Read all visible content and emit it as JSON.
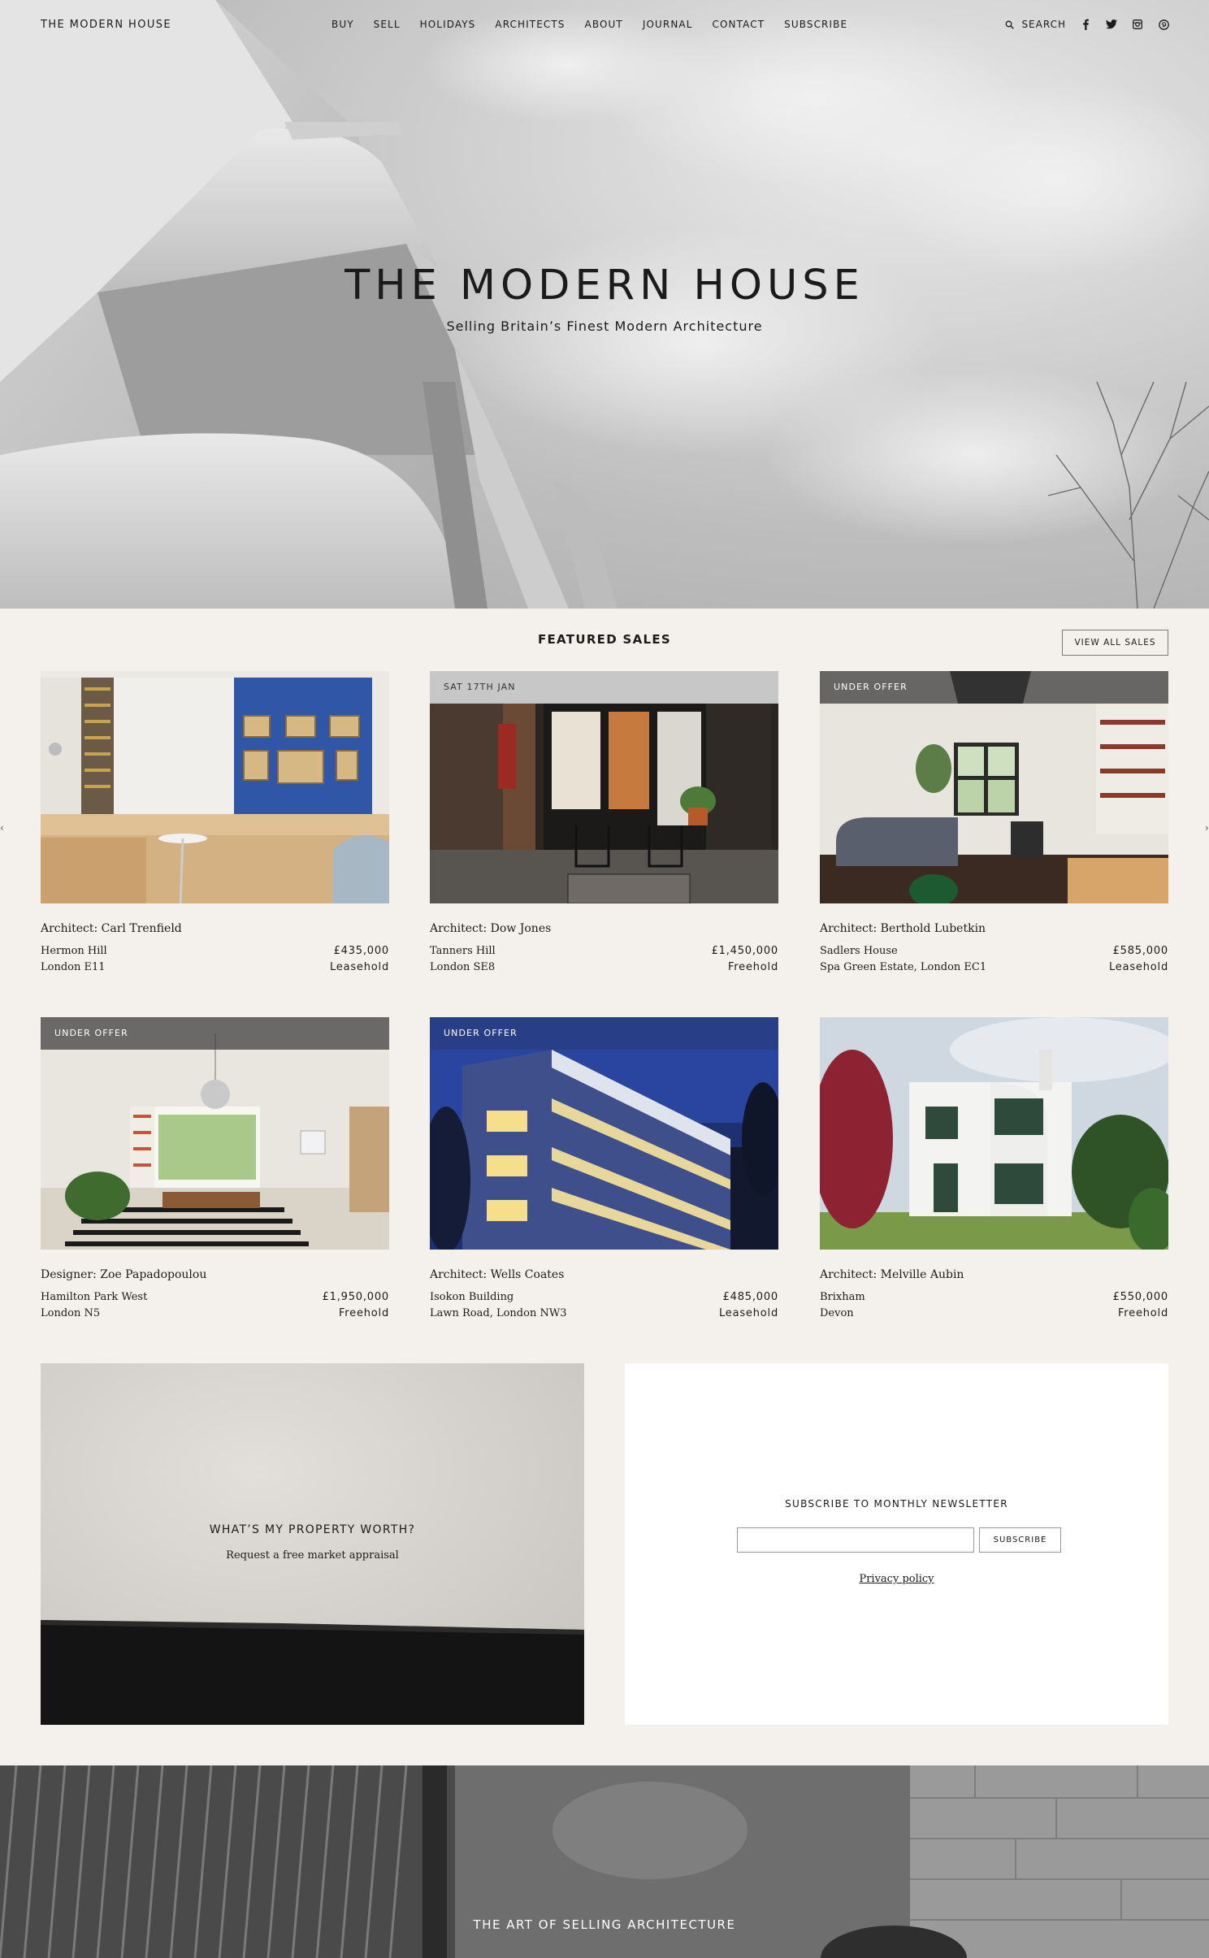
{
  "nav": {
    "brand": "THE MODERN HOUSE",
    "items": [
      {
        "label": "BUY"
      },
      {
        "label": "SELL"
      },
      {
        "label": "HOLIDAYS"
      },
      {
        "label": "ARCHITECTS"
      },
      {
        "label": "ABOUT"
      },
      {
        "label": "JOURNAL"
      },
      {
        "label": "CONTACT"
      },
      {
        "label": "SUBSCRIBE"
      }
    ],
    "search_label": "SEARCH",
    "social_icons": [
      "facebook-icon",
      "twitter-icon",
      "instagram-icon",
      "pinterest-icon"
    ]
  },
  "hero": {
    "title": "THE MODERN HOUSE",
    "subtitle": "Selling Britain’s Finest Modern Architecture"
  },
  "featured": {
    "heading": "FEATURED SALES",
    "view_all": "VIEW ALL SALES",
    "listings": [
      {
        "badge": "",
        "architect": "Architect: Carl Trenfield",
        "name": "Hermon Hill",
        "area": "London E11",
        "price": "£435,000",
        "tenure": "Leasehold"
      },
      {
        "badge": "SAT 17TH JAN",
        "architect": "Architect: Dow Jones",
        "name": "Tanners Hill",
        "area": "London SE8",
        "price": "£1,450,000",
        "tenure": "Freehold"
      },
      {
        "badge": "UNDER OFFER",
        "architect": "Architect: Berthold Lubetkin",
        "name": "Sadlers House",
        "area": "Spa Green Estate, London EC1",
        "price": "£585,000",
        "tenure": "Leasehold"
      },
      {
        "badge": "UNDER OFFER",
        "architect": "Designer: Zoe Papadopoulou",
        "name": "Hamilton Park West",
        "area": "London N5",
        "price": "£1,950,000",
        "tenure": "Freehold"
      },
      {
        "badge": "UNDER OFFER",
        "architect": "Architect: Wells Coates",
        "name": "Isokon Building",
        "area": "Lawn Road, London NW3",
        "price": "£485,000",
        "tenure": "Leasehold"
      },
      {
        "badge": "",
        "architect": "Architect: Melville Aubin",
        "name": "Brixham",
        "area": "Devon",
        "price": "£550,000",
        "tenure": "Freehold"
      }
    ]
  },
  "appraisal": {
    "title": "WHAT’S MY PROPERTY WORTH?",
    "subtitle": "Request a free market appraisal"
  },
  "newsletter": {
    "title": "SUBSCRIBE TO MONTHLY NEWSLETTER",
    "input_value": "",
    "input_placeholder": "",
    "button": "SUBSCRIBE",
    "privacy": "Privacy policy"
  },
  "banner": {
    "title": "THE ART OF SELLING ARCHITECTURE"
  },
  "colors": {
    "page_bg": "#f4f0ec",
    "text": "#1b1b1b",
    "badge_dark": "#3c3c3c",
    "accent_blue": "#2f4a9e"
  }
}
